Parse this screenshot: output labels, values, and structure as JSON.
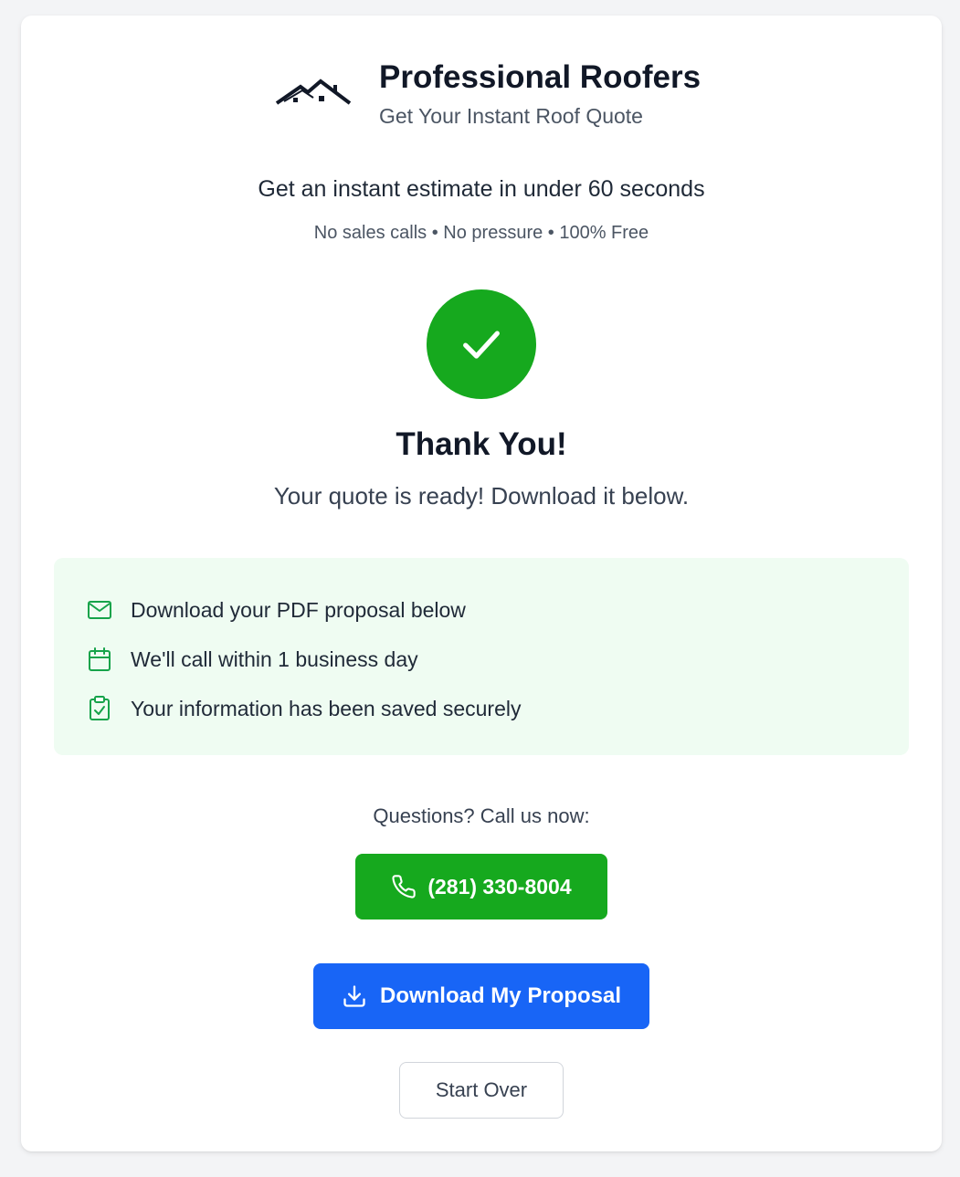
{
  "brand": {
    "title": "Professional Roofers",
    "subtitle": "Get Your Instant Roof Quote",
    "logo_icon": "house-roof-icon"
  },
  "hero": {
    "tagline": "Get an instant estimate in under 60 seconds",
    "subtag": "No sales calls • No pressure • 100% Free"
  },
  "success": {
    "icon": "checkmark-icon",
    "title": "Thank You!",
    "message": "Your quote is ready! Download it below."
  },
  "info": {
    "items": [
      {
        "icon": "mail-icon",
        "label": "Download your PDF proposal below"
      },
      {
        "icon": "calendar-icon",
        "label": "We'll call within 1 business day"
      },
      {
        "icon": "clipboard-check-icon",
        "label": "Your information has been saved securely"
      }
    ]
  },
  "contact": {
    "prompt": "Questions? Call us now:",
    "phone_label": "(281) 330-8004"
  },
  "actions": {
    "download_label": "Download My Proposal",
    "start_over_label": "Start Over"
  },
  "colors": {
    "success_green": "#16a91e",
    "primary_blue": "#1865f6",
    "info_bg": "#effcf2",
    "icon_green": "#16a34a"
  }
}
